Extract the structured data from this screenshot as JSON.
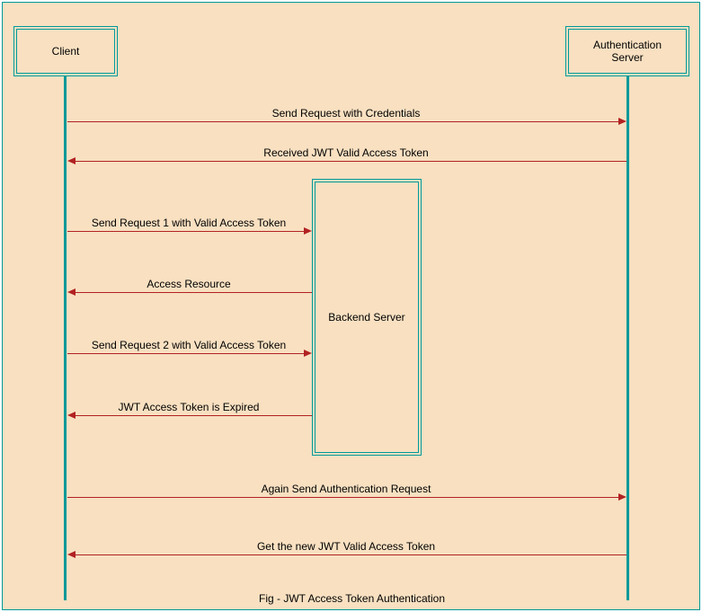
{
  "participants": {
    "client": "Client",
    "auth_server": "Authentication Server",
    "backend": "Backend Server"
  },
  "messages": {
    "m1": "Send Request with Credentials",
    "m2": "Received JWT Valid Access Token",
    "m3": "Send Request 1 with Valid Access Token",
    "m4": "Access Resource",
    "m5": "Send Request 2 with Valid Access Token",
    "m6": "JWT Access Token is Expired",
    "m7": "Again Send Authentication Request",
    "m8": "Get the new JWT Valid Access Token"
  },
  "caption": "Fig -  JWT Access Token Authentication",
  "colors": {
    "bg": "#f8e0c1",
    "stroke": "#009999",
    "arrow": "#b22222"
  }
}
